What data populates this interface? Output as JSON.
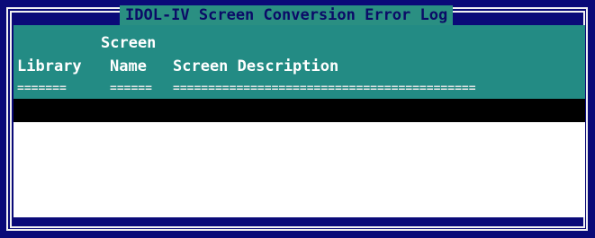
{
  "window": {
    "title": "IDOL-IV Screen Conversion Error Log"
  },
  "columns": {
    "library_line1": "",
    "library_line2": "Library",
    "screen_line1": "Screen",
    "screen_line2": "Name",
    "description_line1": "",
    "description_line2": "Screen Description"
  },
  "separators": {
    "library": "=======",
    "screen": "======",
    "description": "==========================================="
  },
  "colors": {
    "background": "#0a0a78",
    "header_teal": "#238b84",
    "selection_bar": "#000000",
    "content_area": "#ffffff"
  }
}
